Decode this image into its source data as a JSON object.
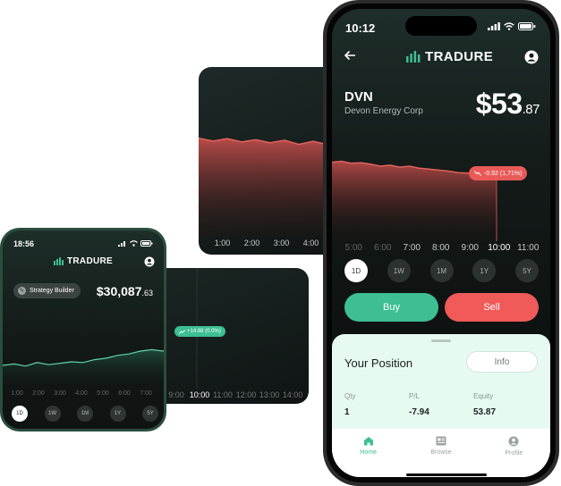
{
  "brand": {
    "name": "TRADURE",
    "accent": "#3dbf93",
    "negative": "#f05a58"
  },
  "top_card": {
    "ticks": [
      "1:00",
      "2:00",
      "3:00",
      "4:00"
    ],
    "series": [
      0.32,
      0.3,
      0.34,
      0.33,
      0.38,
      0.36,
      0.4,
      0.42,
      0.44,
      0.43,
      0.45
    ]
  },
  "bottom_card": {
    "ticks": [
      "9:00",
      "10:00",
      "11:00",
      "12:00",
      "13:00",
      "14:00"
    ],
    "active_tick": "10:00"
  },
  "small_phone": {
    "status_time": "18:56",
    "pill_label": "Strategy Builder",
    "value_main": "$30,087",
    "value_cents": ".63",
    "change_label": "+14.88 (0.0%)",
    "ticks": [
      "1:00",
      "2:00",
      "3:00",
      "4:00",
      "5:00",
      "6:00",
      "7:00"
    ],
    "ranges": [
      "1D",
      "1W",
      "1M",
      "1Y",
      "5Y"
    ],
    "active_range": "1D",
    "series": [
      0.3,
      0.32,
      0.29,
      0.34,
      0.31,
      0.33,
      0.35,
      0.34,
      0.38,
      0.4,
      0.44,
      0.46,
      0.5,
      0.52,
      0.5,
      0.55,
      0.62,
      0.72
    ]
  },
  "big_phone": {
    "status_time": "10:12",
    "ticker": "DVN",
    "company": "Devon Energy Corp",
    "price_main": "$53",
    "price_cents": ".87",
    "change_label": "-0.92 (1,71%)",
    "ticks": [
      "5:00",
      "6:00",
      "7:00",
      "8:00",
      "9:00",
      "10:00",
      "11:00"
    ],
    "active_tick": "10:00",
    "ranges": [
      "1D",
      "1W",
      "1M",
      "1Y",
      "5Y"
    ],
    "active_range": "1D",
    "buy_label": "Buy",
    "sell_label": "Sell",
    "position": {
      "title": "Your Position",
      "info_label": "Info",
      "stats": [
        {
          "label": "Qty",
          "value": "1"
        },
        {
          "label": "P/L",
          "value": "-7.94"
        },
        {
          "label": "Equity",
          "value": "53.87"
        }
      ]
    },
    "nav": [
      {
        "label": "Home",
        "icon": "home-icon",
        "active": true
      },
      {
        "label": "Browse",
        "icon": "newspaper-icon",
        "active": false
      },
      {
        "label": "Profile",
        "icon": "user-icon",
        "active": false
      }
    ],
    "series": [
      0.12,
      0.1,
      0.14,
      0.13,
      0.16,
      0.2,
      0.18,
      0.22,
      0.2,
      0.24,
      0.26,
      0.28,
      0.3,
      0.33,
      0.34,
      0.36,
      0.4,
      0.42
    ]
  }
}
